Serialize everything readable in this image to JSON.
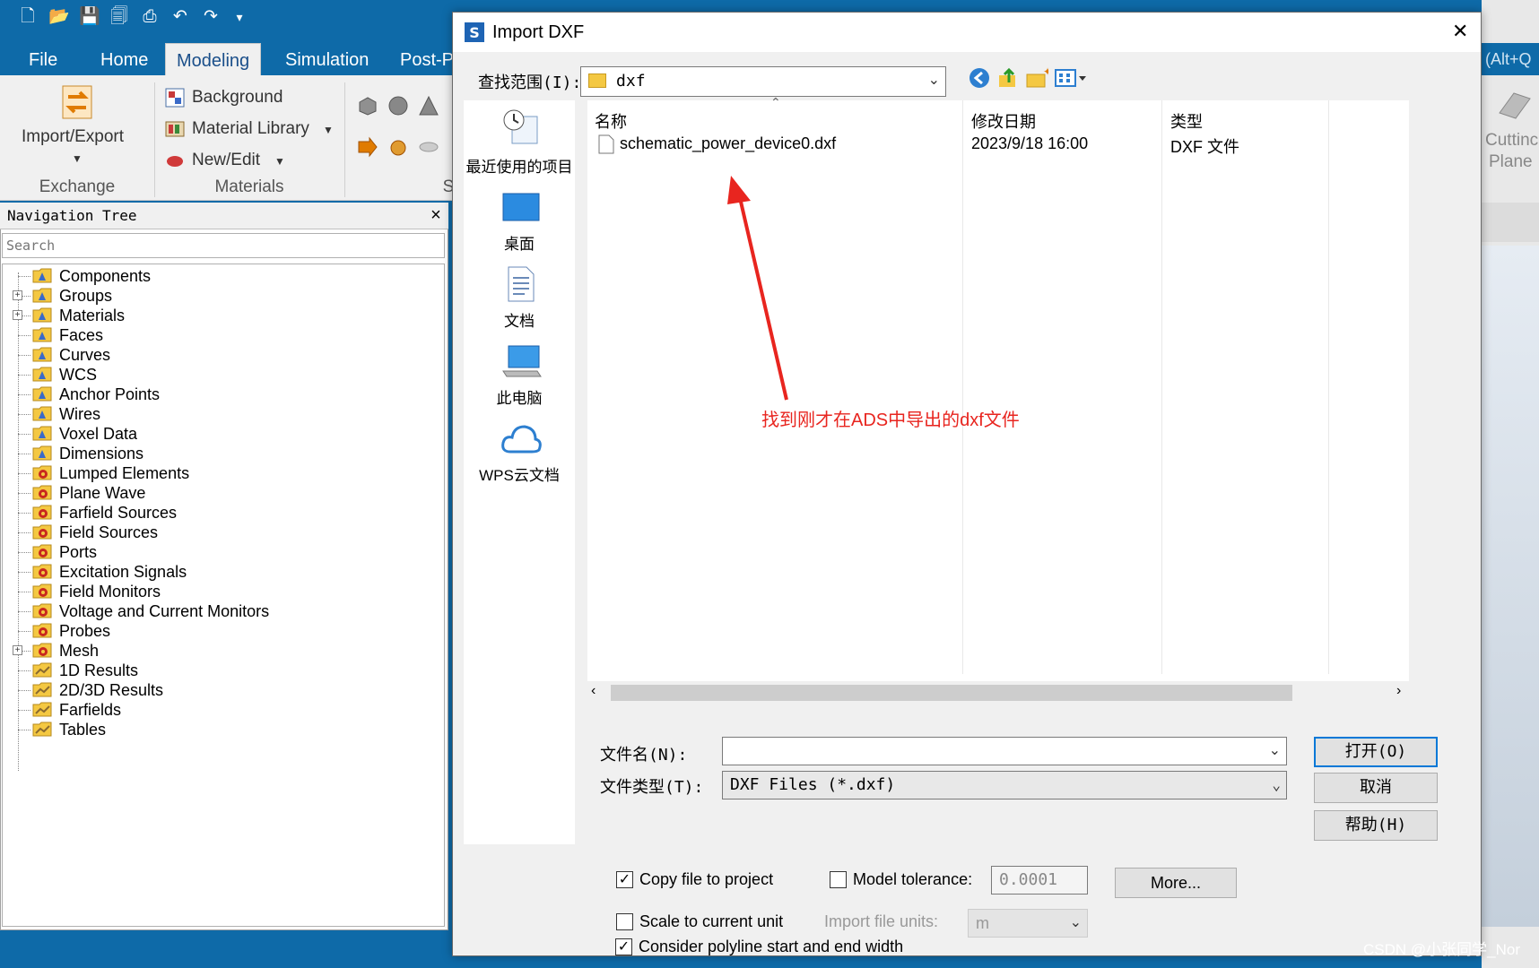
{
  "app": {
    "menu_tabs": [
      "File",
      "Home",
      "Modeling",
      "Simulation",
      "Post-Pr"
    ],
    "active_tab": "Modeling",
    "search_hint": "(Alt+Q",
    "ribbon": {
      "import_export": "Import/Export",
      "exchange_group": "Exchange",
      "background": "Background",
      "material_library": "Material Library",
      "new_edit": "New/Edit",
      "materials_group": "Materials",
      "shapes_group_partial": "S",
      "cutting_plane_1": "Cuttinc",
      "cutting_plane_2": "Plane"
    },
    "nav_tree": {
      "title": "Navigation Tree",
      "close": "×",
      "search_placeholder": "Search",
      "items": [
        {
          "label": "Components",
          "expandable": false,
          "icon": "folder-icon"
        },
        {
          "label": "Groups",
          "expandable": true,
          "icon": "folder-icon"
        },
        {
          "label": "Materials",
          "expandable": true,
          "icon": "folder-icon"
        },
        {
          "label": "Faces",
          "expandable": false,
          "icon": "folder-icon"
        },
        {
          "label": "Curves",
          "expandable": false,
          "icon": "folder-icon"
        },
        {
          "label": "WCS",
          "expandable": false,
          "icon": "folder-icon"
        },
        {
          "label": "Anchor Points",
          "expandable": false,
          "icon": "folder-icon"
        },
        {
          "label": "Wires",
          "expandable": false,
          "icon": "folder-icon"
        },
        {
          "label": "Voxel Data",
          "expandable": false,
          "icon": "folder-icon"
        },
        {
          "label": "Dimensions",
          "expandable": false,
          "icon": "folder-icon"
        },
        {
          "label": "Lumped Elements",
          "expandable": false,
          "icon": "gear-folder-icon"
        },
        {
          "label": "Plane Wave",
          "expandable": false,
          "icon": "gear-folder-icon"
        },
        {
          "label": "Farfield Sources",
          "expandable": false,
          "icon": "gear-folder-icon"
        },
        {
          "label": "Field Sources",
          "expandable": false,
          "icon": "gear-folder-icon"
        },
        {
          "label": "Ports",
          "expandable": false,
          "icon": "gear-folder-icon"
        },
        {
          "label": "Excitation Signals",
          "expandable": false,
          "icon": "gear-folder-icon"
        },
        {
          "label": "Field Monitors",
          "expandable": false,
          "icon": "gear-folder-icon"
        },
        {
          "label": "Voltage and Current Monitors",
          "expandable": false,
          "icon": "gear-folder-icon"
        },
        {
          "label": "Probes",
          "expandable": false,
          "icon": "gear-folder-icon"
        },
        {
          "label": "Mesh",
          "expandable": true,
          "icon": "gear-folder-icon"
        },
        {
          "label": "1D Results",
          "expandable": false,
          "icon": "results-folder-icon"
        },
        {
          "label": "2D/3D Results",
          "expandable": false,
          "icon": "results-folder-icon"
        },
        {
          "label": "Farfields",
          "expandable": false,
          "icon": "results-folder-icon"
        },
        {
          "label": "Tables",
          "expandable": false,
          "icon": "results-folder-icon"
        }
      ]
    }
  },
  "dialog": {
    "title": "Import DXF",
    "close": "✕",
    "look_in_label": "查找范围(I):",
    "look_in_value": "dxf",
    "places": [
      "最近使用的项目",
      "桌面",
      "文档",
      "此电脑",
      "WPS云文档"
    ],
    "columns": {
      "name": "名称",
      "date": "修改日期",
      "type": "类型"
    },
    "files": [
      {
        "name": "schematic_power_device0.dxf",
        "date": "2023/9/18 16:00",
        "type": "DXF 文件"
      }
    ],
    "annotation": "找到刚才在ADS中导出的dxf文件",
    "filename_label": "文件名(N):",
    "filename_value": "",
    "filetype_label": "文件类型(T):",
    "filetype_value": "DXF Files (*.dxf)",
    "open_button": "打开(O)",
    "cancel_button": "取消",
    "help_button": "帮助(H)",
    "copy_file_label": "Copy file to project",
    "copy_file_checked": true,
    "model_tolerance_label": "Model tolerance:",
    "model_tolerance_checked": false,
    "model_tolerance_value": "0.0001",
    "more_button": "More...",
    "scale_label": "Scale to current unit",
    "scale_checked": false,
    "import_units_label": "Import file units:",
    "import_units_value": "m",
    "polyline_label": "Consider polyline start and end width",
    "polyline_checked": true
  },
  "watermark": "CSDN @小张同学_Nor",
  "colors": {
    "accent": "#0e6aa8",
    "annotation": "#e8251f",
    "default_button_border": "#0078d7"
  }
}
